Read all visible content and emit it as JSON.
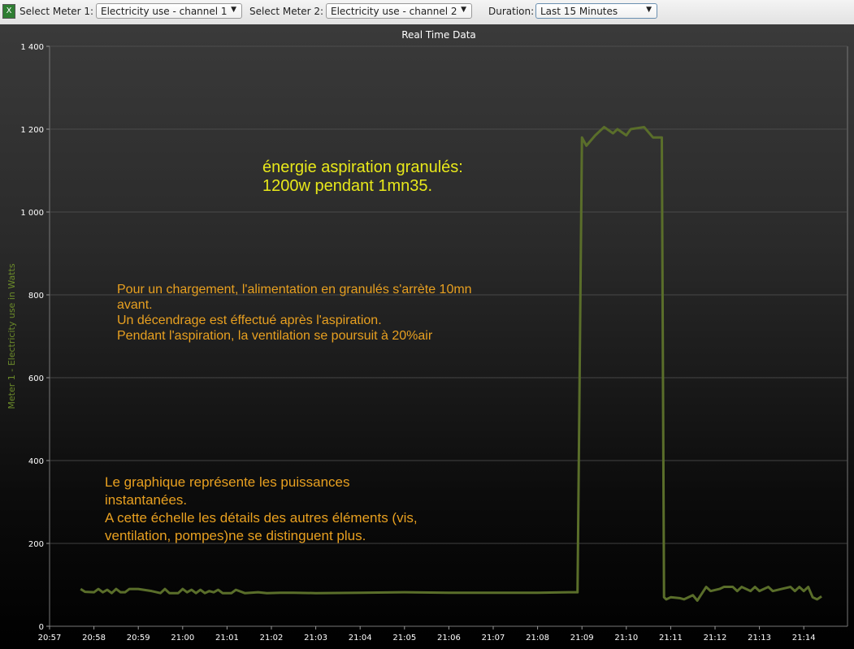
{
  "toolbar": {
    "excel_icon": "excel-export-icon",
    "meter1_label": "Select Meter 1:",
    "meter1_value": "Electricity use - channel 1",
    "meter2_label": "Select Meter 2:",
    "meter2_value": "Electricity use - channel 2",
    "duration_label": "Duration:",
    "duration_value": "Last 15 Minutes"
  },
  "annotations": {
    "a1": "énergie aspiration granulés:\n1200w pendant 1mn35.",
    "a2": "Pour un chargement, l'alimentation en granulés s'arrète 10mn\navant.\nUn décendrage est éffectué après l'aspiration.\nPendant l'aspiration, la ventilation se poursuit à 20%air",
    "a3": "Le graphique représente les puissances\ninstantanées.\nA cette échelle les détails des autres éléments (vis,\nventilation, pompes)ne se distinguent plus.",
    "colors": {
      "a1": "#e8e81a",
      "a2": "#e8a020",
      "a3": "#e8a020"
    }
  },
  "chart_data": {
    "type": "line",
    "title": "Real Time Data",
    "xlabel": "",
    "ylabel": "Meter 1 - Electricity use in Watts",
    "x_unit": "minutes after 20:57",
    "xlim": [
      0,
      18
    ],
    "ylim": [
      0,
      1400
    ],
    "xticks": [
      {
        "v": 0,
        "label": "20:57"
      },
      {
        "v": 1,
        "label": "20:58"
      },
      {
        "v": 2,
        "label": "20:59"
      },
      {
        "v": 3,
        "label": "21:00"
      },
      {
        "v": 4,
        "label": "21:01"
      },
      {
        "v": 5,
        "label": "21:02"
      },
      {
        "v": 6,
        "label": "21:03"
      },
      {
        "v": 7,
        "label": "21:04"
      },
      {
        "v": 8,
        "label": "21:05"
      },
      {
        "v": 9,
        "label": "21:06"
      },
      {
        "v": 10,
        "label": "21:07"
      },
      {
        "v": 11,
        "label": "21:08"
      },
      {
        "v": 12,
        "label": "21:09"
      },
      {
        "v": 13,
        "label": "21:10"
      },
      {
        "v": 14,
        "label": "21:11"
      },
      {
        "v": 15,
        "label": "21:12"
      },
      {
        "v": 16,
        "label": "21:13"
      },
      {
        "v": 17,
        "label": "21:14"
      }
    ],
    "yticks": [
      {
        "v": 0,
        "label": "0"
      },
      {
        "v": 200,
        "label": "200"
      },
      {
        "v": 400,
        "label": "400"
      },
      {
        "v": 600,
        "label": "600"
      },
      {
        "v": 800,
        "label": "800"
      },
      {
        "v": 1000,
        "label": "1 000"
      },
      {
        "v": 1200,
        "label": "1 200"
      },
      {
        "v": 1400,
        "label": "1 400"
      }
    ],
    "grid": true,
    "series_color": "#5a6e2a",
    "series": [
      {
        "name": "Meter 1",
        "points": [
          [
            0.7,
            90
          ],
          [
            0.8,
            83
          ],
          [
            1.0,
            82
          ],
          [
            1.1,
            90
          ],
          [
            1.2,
            82
          ],
          [
            1.3,
            88
          ],
          [
            1.4,
            80
          ],
          [
            1.5,
            90
          ],
          [
            1.6,
            82
          ],
          [
            1.7,
            82
          ],
          [
            1.8,
            90
          ],
          [
            2.0,
            90
          ],
          [
            2.3,
            85
          ],
          [
            2.5,
            80
          ],
          [
            2.6,
            90
          ],
          [
            2.7,
            80
          ],
          [
            2.9,
            80
          ],
          [
            3.0,
            90
          ],
          [
            3.1,
            82
          ],
          [
            3.2,
            88
          ],
          [
            3.3,
            80
          ],
          [
            3.4,
            88
          ],
          [
            3.5,
            80
          ],
          [
            3.6,
            85
          ],
          [
            3.7,
            82
          ],
          [
            3.8,
            88
          ],
          [
            3.9,
            80
          ],
          [
            4.1,
            80
          ],
          [
            4.2,
            88
          ],
          [
            4.4,
            80
          ],
          [
            4.7,
            82
          ],
          [
            4.9,
            80
          ],
          [
            5.2,
            81
          ],
          [
            5.5,
            81
          ],
          [
            6.0,
            80
          ],
          [
            7.0,
            81
          ],
          [
            8.0,
            82
          ],
          [
            9.0,
            81
          ],
          [
            10.0,
            81
          ],
          [
            11.0,
            81
          ],
          [
            11.7,
            82
          ],
          [
            11.9,
            82
          ],
          [
            12.0,
            1180
          ],
          [
            12.1,
            1160
          ],
          [
            12.3,
            1185
          ],
          [
            12.5,
            1205
          ],
          [
            12.7,
            1190
          ],
          [
            12.8,
            1200
          ],
          [
            13.0,
            1185
          ],
          [
            13.1,
            1200
          ],
          [
            13.4,
            1205
          ],
          [
            13.6,
            1180
          ],
          [
            13.8,
            1180
          ],
          [
            13.85,
            70
          ],
          [
            13.9,
            65
          ],
          [
            14.0,
            70
          ],
          [
            14.2,
            68
          ],
          [
            14.3,
            65
          ],
          [
            14.5,
            75
          ],
          [
            14.6,
            62
          ],
          [
            14.8,
            95
          ],
          [
            14.9,
            85
          ],
          [
            15.1,
            90
          ],
          [
            15.2,
            95
          ],
          [
            15.4,
            95
          ],
          [
            15.5,
            85
          ],
          [
            15.6,
            95
          ],
          [
            15.8,
            85
          ],
          [
            15.9,
            95
          ],
          [
            16.0,
            85
          ],
          [
            16.2,
            95
          ],
          [
            16.3,
            85
          ],
          [
            16.5,
            90
          ],
          [
            16.7,
            95
          ],
          [
            16.8,
            85
          ],
          [
            16.9,
            95
          ],
          [
            17.0,
            85
          ],
          [
            17.1,
            95
          ],
          [
            17.2,
            70
          ],
          [
            17.3,
            65
          ],
          [
            17.4,
            72
          ]
        ]
      }
    ]
  }
}
